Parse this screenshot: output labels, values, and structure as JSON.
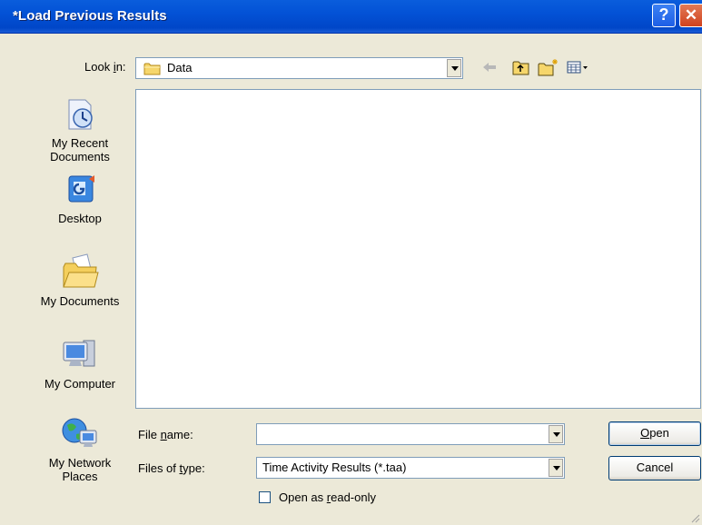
{
  "window": {
    "title": "*Load Previous Results"
  },
  "title_buttons": {
    "help": "?",
    "close": "✕"
  },
  "look_in": {
    "label_pre": "Look ",
    "label_key": "i",
    "label_post": "n:",
    "value": "Data"
  },
  "places": [
    {
      "name": "My Recent Documents",
      "line1": "My Recent",
      "line2": "Documents",
      "icon": "recent-documents-icon"
    },
    {
      "name": "Desktop",
      "line1": "Desktop",
      "line2": "",
      "icon": "desktop-icon"
    },
    {
      "name": "My Documents",
      "line1": "My Documents",
      "line2": "",
      "icon": "my-documents-icon"
    },
    {
      "name": "My Computer",
      "line1": "My Computer",
      "line2": "",
      "icon": "my-computer-icon"
    },
    {
      "name": "My Network Places",
      "line1": "My Network",
      "line2": "Places",
      "icon": "network-places-icon"
    }
  ],
  "file_name": {
    "label_pre": "File ",
    "label_key": "n",
    "label_post": "ame:",
    "value": ""
  },
  "file_type": {
    "label_pre": "Files of ",
    "label_key": "t",
    "label_post": "ype:",
    "value": "Time Activity Results (*.taa)"
  },
  "buttons": {
    "open_key": "O",
    "open_rest": "pen",
    "cancel": "Cancel"
  },
  "readonly": {
    "label_pre": "Open as ",
    "label_key": "r",
    "label_post": "ead-only",
    "checked": false
  },
  "colors": {
    "titlebar": "#0052d6",
    "dialog": "#ece9d8",
    "close_button": "#d0421e"
  }
}
